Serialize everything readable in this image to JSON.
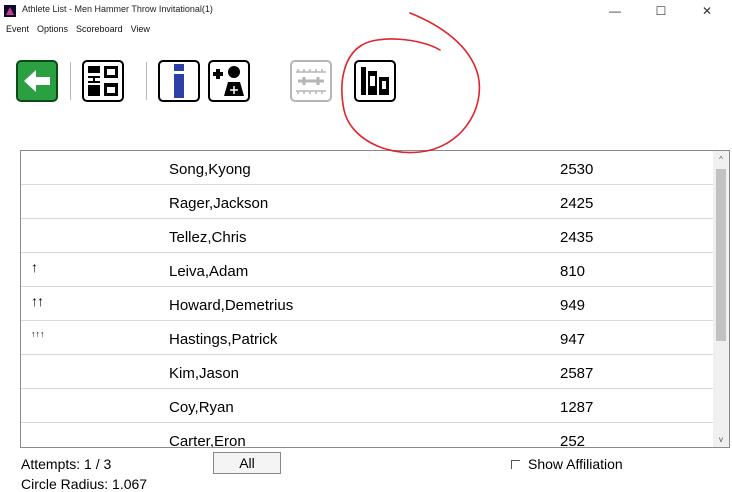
{
  "window": {
    "title": "Athlete List - Men Hammer Throw Invitational(1)",
    "minimize_glyph": "—",
    "maximize_glyph": "☐",
    "close_glyph": "✕"
  },
  "menu": [
    "Event",
    "Options",
    "Scoreboard",
    "View"
  ],
  "toolbar": {
    "buttons": [
      {
        "icon": "back-arrow-icon",
        "enabled": true
      },
      {
        "icon": "reorder-icon",
        "enabled": true
      },
      {
        "icon": "info-icon",
        "enabled": true
      },
      {
        "icon": "add-athlete-icon",
        "enabled": true
      },
      {
        "icon": "ruler-icon",
        "enabled": false
      },
      {
        "icon": "bar-chart-icon",
        "enabled": true
      }
    ],
    "accent_green": "#1f9a3a",
    "accent_blue": "#2f3fa8"
  },
  "athletes": [
    {
      "mark": "",
      "name": "Song,Kyong",
      "score": "2530"
    },
    {
      "mark": "",
      "name": "Rager,Jackson",
      "score": "2425"
    },
    {
      "mark": "",
      "name": "Tellez,Chris",
      "score": "2435"
    },
    {
      "mark": "↑",
      "name": "Leiva,Adam",
      "score": "810"
    },
    {
      "mark": "↑↑",
      "name": "Howard,Demetrius",
      "score": "949"
    },
    {
      "mark": "↑↑↑",
      "name": "Hastings,Patrick",
      "score": "947"
    },
    {
      "mark": "",
      "name": "Kim,Jason",
      "score": "2587"
    },
    {
      "mark": "",
      "name": "Coy,Ryan",
      "score": "1287"
    },
    {
      "mark": "",
      "name": "Carter,Eron",
      "score": "252"
    }
  ],
  "scroll": {
    "up_glyph": "^",
    "down_glyph": "v"
  },
  "footer": {
    "attempts": "Attempts: 1 / 3",
    "all_button": "All",
    "show_affiliation": "Show Affiliation",
    "circle_radius": "Circle Radius: 1.067"
  },
  "annotation_color": "#e0242b"
}
